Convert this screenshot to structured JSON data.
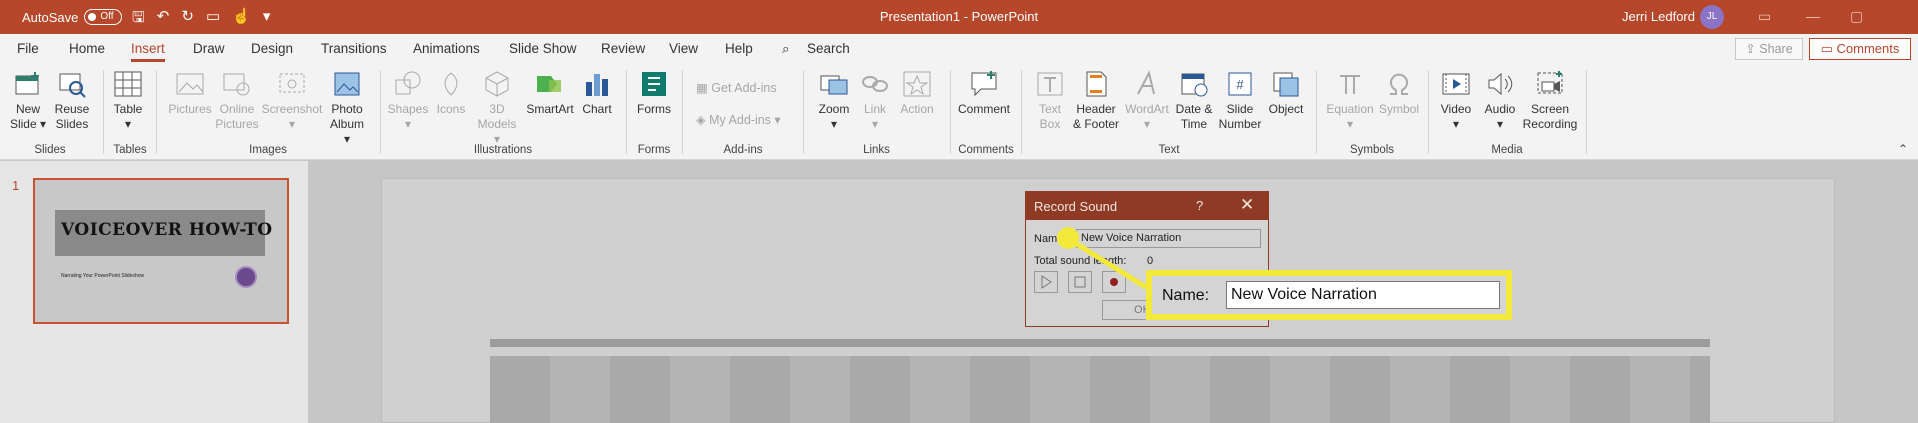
{
  "titlebar": {
    "autosave_label": "AutoSave",
    "autosave_state": "Off",
    "doc_title": "Presentation1  -  PowerPoint",
    "user_name": "Jerri Ledford",
    "user_initials": "JL"
  },
  "tabs": [
    "File",
    "Home",
    "Insert",
    "Draw",
    "Design",
    "Transitions",
    "Animations",
    "Slide Show",
    "Review",
    "View",
    "Help"
  ],
  "active_tab": "Insert",
  "search_label": "Search",
  "share_label": "Share",
  "comments_label": "Comments",
  "ribbon": {
    "buttons": [
      {
        "id": "new-slide",
        "line1": "New",
        "line2": "Slide ▾",
        "enabled": true
      },
      {
        "id": "reuse-slides",
        "line1": "Reuse",
        "line2": "Slides",
        "enabled": true
      },
      {
        "id": "table",
        "line1": "Table",
        "line2": "▾",
        "enabled": true
      },
      {
        "id": "pictures",
        "line1": "Pictures",
        "line2": "",
        "enabled": false
      },
      {
        "id": "online-pictures",
        "line1": "Online",
        "line2": "Pictures",
        "enabled": false
      },
      {
        "id": "screenshot",
        "line1": "Screenshot",
        "line2": "▾",
        "enabled": false
      },
      {
        "id": "photo-album",
        "line1": "Photo",
        "line2": "Album ▾",
        "enabled": true
      },
      {
        "id": "shapes",
        "line1": "Shapes",
        "line2": "▾",
        "enabled": false
      },
      {
        "id": "icons",
        "line1": "Icons",
        "line2": "",
        "enabled": false
      },
      {
        "id": "3d-models",
        "line1": "3D",
        "line2": "Models ▾",
        "enabled": false
      },
      {
        "id": "smartart",
        "line1": "SmartArt",
        "line2": "",
        "enabled": true
      },
      {
        "id": "chart",
        "line1": "Chart",
        "line2": "",
        "enabled": true
      },
      {
        "id": "forms",
        "line1": "Forms",
        "line2": "",
        "enabled": true
      },
      {
        "id": "zoom",
        "line1": "Zoom",
        "line2": "▾",
        "enabled": true
      },
      {
        "id": "link",
        "line1": "Link",
        "line2": "▾",
        "enabled": false
      },
      {
        "id": "action",
        "line1": "Action",
        "line2": "",
        "enabled": false
      },
      {
        "id": "comment",
        "line1": "Comment",
        "line2": "",
        "enabled": true
      },
      {
        "id": "text-box",
        "line1": "Text",
        "line2": "Box",
        "enabled": false
      },
      {
        "id": "header-footer",
        "line1": "Header",
        "line2": "& Footer",
        "enabled": true
      },
      {
        "id": "wordart",
        "line1": "WordArt",
        "line2": "▾",
        "enabled": false
      },
      {
        "id": "date-time",
        "line1": "Date &",
        "line2": "Time",
        "enabled": true
      },
      {
        "id": "slide-number",
        "line1": "Slide",
        "line2": "Number",
        "enabled": true
      },
      {
        "id": "object",
        "line1": "Object",
        "line2": "",
        "enabled": true
      },
      {
        "id": "equation",
        "line1": "Equation",
        "line2": "▾",
        "enabled": false
      },
      {
        "id": "symbol",
        "line1": "Symbol",
        "line2": "",
        "enabled": false
      },
      {
        "id": "video",
        "line1": "Video",
        "line2": "▾",
        "enabled": true
      },
      {
        "id": "audio",
        "line1": "Audio",
        "line2": "▾",
        "enabled": true
      },
      {
        "id": "screen-recording",
        "line1": "Screen",
        "line2": "Recording",
        "enabled": true
      }
    ],
    "addins": {
      "get": "Get Add-ins",
      "my": "My Add-ins"
    },
    "groups": [
      "Slides",
      "Tables",
      "Images",
      "Illustrations",
      "Forms",
      "Add-ins",
      "Links",
      "Comments",
      "Text",
      "Symbols",
      "Media"
    ]
  },
  "thumbnail": {
    "number": "1",
    "title": "VOICEOVER HOW-TO",
    "subtitle": "Narrating Your PowerPoint Slideshow"
  },
  "dialog": {
    "title": "Record Sound",
    "help": "?",
    "close": "✕",
    "name_label": "Name:",
    "name_value": "New Voice Narration",
    "length_label": "Total sound length:",
    "length_value": "0",
    "ok_label": "OK"
  },
  "callout": {
    "label": "Name:",
    "value": "New Voice Narration"
  },
  "colors": {
    "accent": "#b7472a",
    "highlight": "#f2e93a"
  }
}
